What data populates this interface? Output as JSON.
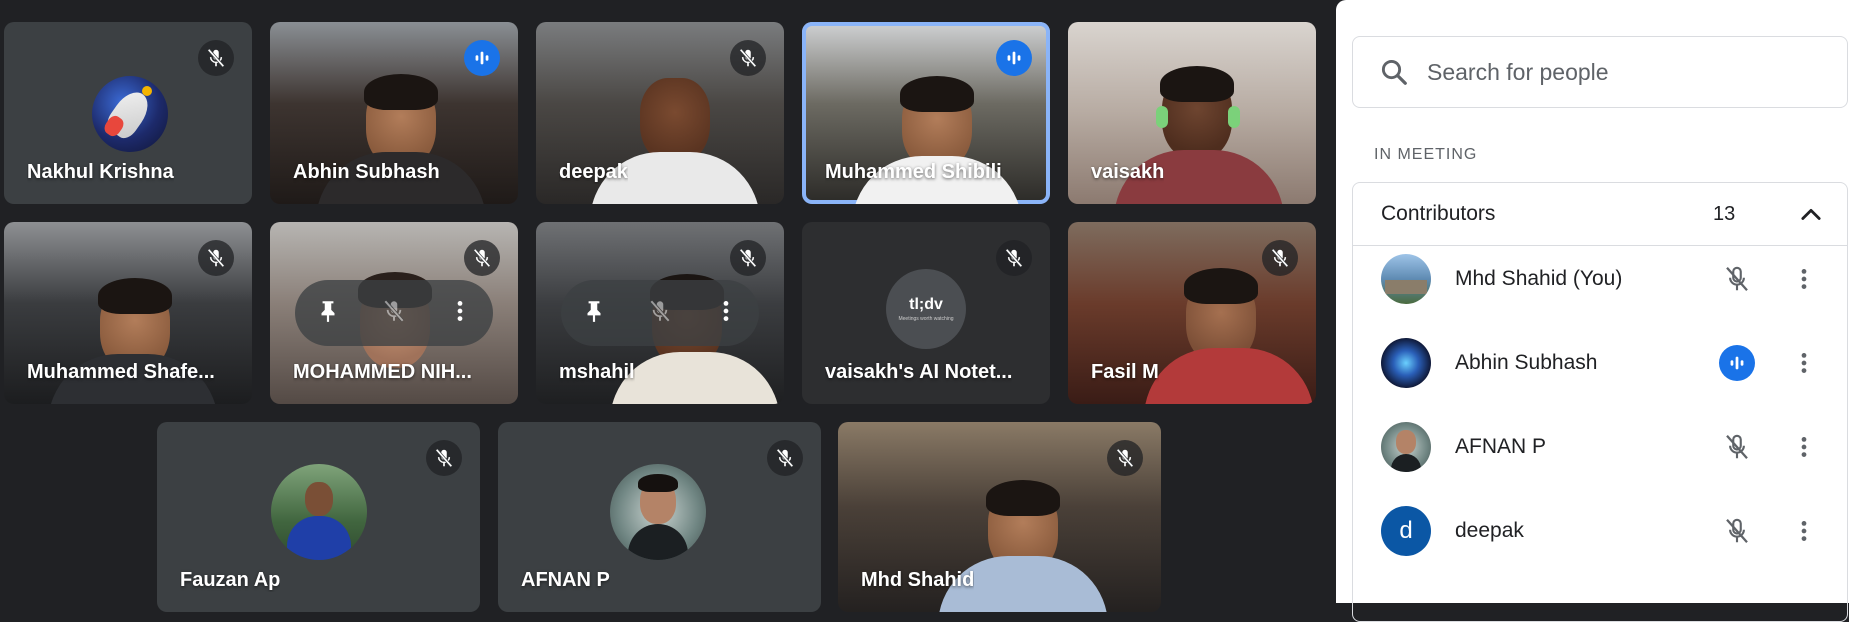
{
  "tiles": [
    {
      "name": "Nakhul Krishna",
      "status": "muted"
    },
    {
      "name": "Abhin Subhash",
      "status": "speaking"
    },
    {
      "name": "deepak",
      "status": "muted"
    },
    {
      "name": "Muhammed Shibili",
      "status": "speaking-active"
    },
    {
      "name": "vaisakh",
      "status": "video"
    },
    {
      "name": "Muhammed Shafe...",
      "status": "muted"
    },
    {
      "name": "MOHAMMED NIH...",
      "status": "muted"
    },
    {
      "name": "mshahil",
      "status": "muted"
    },
    {
      "name": "vaisakh's AI Notet...",
      "status": "muted"
    },
    {
      "name": "Fasil M",
      "status": "muted"
    },
    {
      "name": "Fauzan Ap",
      "status": "muted"
    },
    {
      "name": "AFNAN P",
      "status": "muted"
    },
    {
      "name": "Mhd Shahid",
      "status": "muted"
    }
  ],
  "tldv": {
    "logo": "tl;dv",
    "tagline": "Meetings worth watching"
  },
  "panel": {
    "search_placeholder": "Search for people",
    "section_label": "IN MEETING",
    "group_title": "Contributors",
    "group_count": "13",
    "people": [
      {
        "name": "Mhd Shahid (You)",
        "mic": "muted"
      },
      {
        "name": "Abhin Subhash",
        "mic": "speaking"
      },
      {
        "name": "AFNAN P",
        "mic": "muted"
      },
      {
        "name": "deepak",
        "mic": "muted",
        "initial": "d"
      }
    ]
  },
  "colors": {
    "accent": "#1a73e8",
    "active_border": "#8ab4f8",
    "background": "#202124",
    "tile": "#3c4043"
  }
}
